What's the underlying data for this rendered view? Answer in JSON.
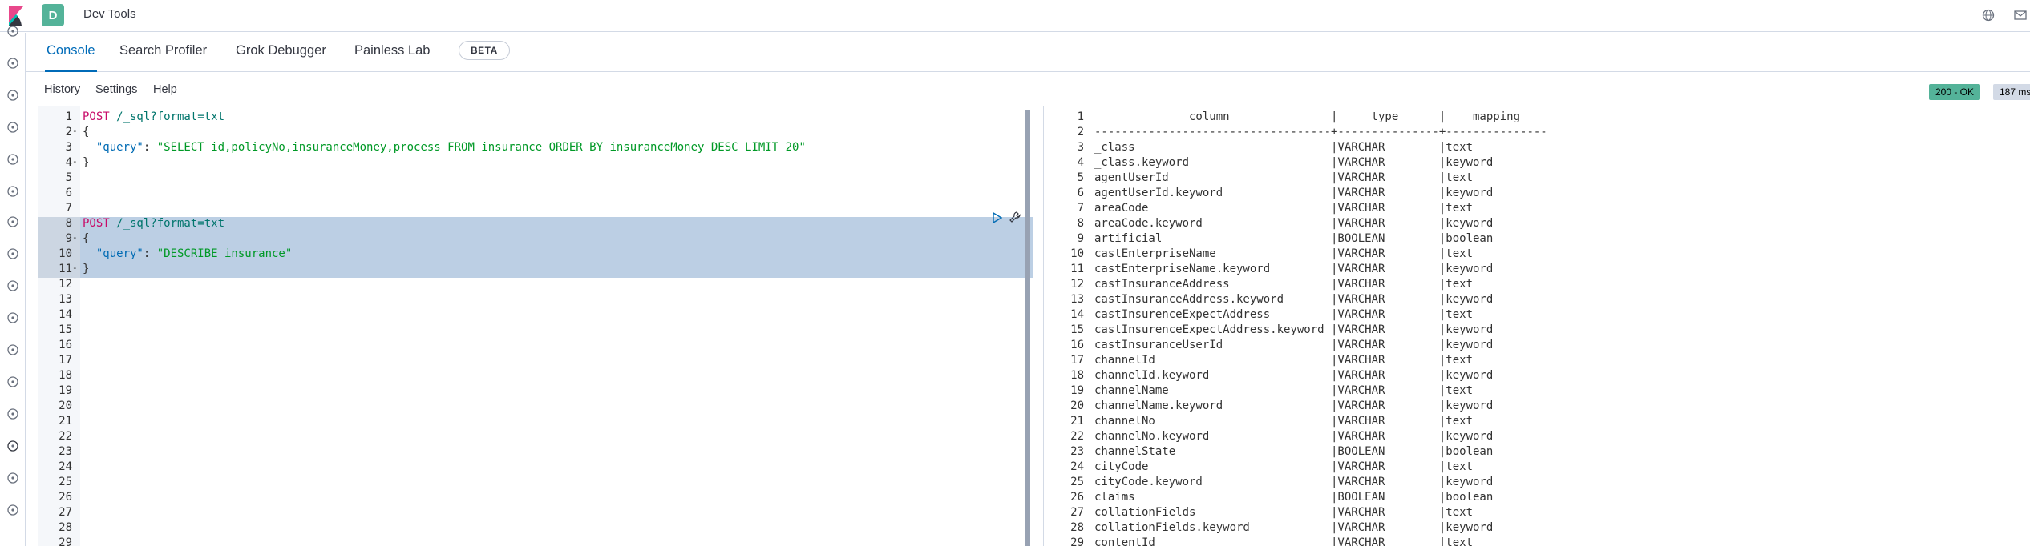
{
  "app": {
    "space_initial": "D",
    "title": "Dev Tools"
  },
  "tabs": [
    {
      "label": "Console",
      "active": true
    },
    {
      "label": "Search Profiler",
      "active": false
    },
    {
      "label": "Grok Debugger",
      "active": false
    },
    {
      "label": "Painless Lab",
      "active": false
    }
  ],
  "beta_badge": "BETA",
  "subnav": {
    "history": "History",
    "settings": "Settings",
    "help": "Help"
  },
  "status": {
    "code": "200 - OK",
    "time": "187 ms"
  },
  "editor": {
    "lines": [
      {
        "n": "1",
        "fold": "",
        "method": "POST",
        "path": " /_sql?format=txt",
        "code": ""
      },
      {
        "n": "2",
        "fold": "-",
        "code": "{"
      },
      {
        "n": "3",
        "fold": "",
        "key": "  \"query\"",
        "str": "\"SELECT id,policyNo,insuranceMoney,process FROM insurance ORDER BY insuranceMoney DESC LIMIT 20\""
      },
      {
        "n": "4",
        "fold": "-",
        "code": "}"
      },
      {
        "n": "5",
        "fold": "",
        "code": ""
      },
      {
        "n": "6",
        "fold": "",
        "code": ""
      },
      {
        "n": "7",
        "fold": "",
        "code": ""
      },
      {
        "n": "8",
        "fold": "",
        "method": "POST",
        "path": " /_sql?format=txt",
        "code": ""
      },
      {
        "n": "9",
        "fold": "-",
        "code": "{"
      },
      {
        "n": "10",
        "fold": "",
        "key": "  \"query\"",
        "str": "\"DESCRIBE insurance\""
      },
      {
        "n": "11",
        "fold": "-",
        "code": "}"
      },
      {
        "n": "12",
        "fold": "",
        "code": ""
      },
      {
        "n": "13",
        "fold": "",
        "code": ""
      },
      {
        "n": "14",
        "fold": "",
        "code": ""
      },
      {
        "n": "15",
        "fold": "",
        "code": ""
      },
      {
        "n": "16",
        "fold": "",
        "code": ""
      },
      {
        "n": "17",
        "fold": "",
        "code": ""
      },
      {
        "n": "18",
        "fold": "",
        "code": ""
      },
      {
        "n": "19",
        "fold": "",
        "code": ""
      },
      {
        "n": "20",
        "fold": "",
        "code": ""
      },
      {
        "n": "21",
        "fold": "",
        "code": ""
      },
      {
        "n": "22",
        "fold": "",
        "code": ""
      },
      {
        "n": "23",
        "fold": "",
        "code": ""
      },
      {
        "n": "24",
        "fold": "",
        "code": ""
      },
      {
        "n": "25",
        "fold": "",
        "code": ""
      },
      {
        "n": "26",
        "fold": "",
        "code": ""
      },
      {
        "n": "27",
        "fold": "",
        "code": ""
      },
      {
        "n": "28",
        "fold": "",
        "code": ""
      },
      {
        "n": "29",
        "fold": "",
        "code": ""
      }
    ]
  },
  "output": {
    "lines": [
      {
        "n": "1",
        "text": "              column               |     type      |    mapping"
      },
      {
        "n": "2",
        "text": "-----------------------------------+---------------+---------------"
      },
      {
        "n": "3",
        "text": "_class                             |VARCHAR        |text"
      },
      {
        "n": "4",
        "text": "_class.keyword                     |VARCHAR        |keyword"
      },
      {
        "n": "5",
        "text": "agentUserId                        |VARCHAR        |text"
      },
      {
        "n": "6",
        "text": "agentUserId.keyword                |VARCHAR        |keyword"
      },
      {
        "n": "7",
        "text": "areaCode                           |VARCHAR        |text"
      },
      {
        "n": "8",
        "text": "areaCode.keyword                   |VARCHAR        |keyword"
      },
      {
        "n": "9",
        "text": "artificial                         |BOOLEAN        |boolean"
      },
      {
        "n": "10",
        "text": "castEnterpriseName                 |VARCHAR        |text"
      },
      {
        "n": "11",
        "text": "castEnterpriseName.keyword         |VARCHAR        |keyword"
      },
      {
        "n": "12",
        "text": "castInsuranceAddress               |VARCHAR        |text"
      },
      {
        "n": "13",
        "text": "castInsuranceAddress.keyword       |VARCHAR        |keyword"
      },
      {
        "n": "14",
        "text": "castInsurenceExpectAddress         |VARCHAR        |text"
      },
      {
        "n": "15",
        "text": "castInsurenceExpectAddress.keyword |VARCHAR        |keyword"
      },
      {
        "n": "16",
        "text": "castInsuranceUserId                |VARCHAR        |keyword"
      },
      {
        "n": "17",
        "text": "channelId                          |VARCHAR        |text"
      },
      {
        "n": "18",
        "text": "channelId.keyword                  |VARCHAR        |keyword"
      },
      {
        "n": "19",
        "text": "channelName                        |VARCHAR        |text"
      },
      {
        "n": "20",
        "text": "channelName.keyword                |VARCHAR        |keyword"
      },
      {
        "n": "21",
        "text": "channelNo                          |VARCHAR        |text"
      },
      {
        "n": "22",
        "text": "channelNo.keyword                  |VARCHAR        |keyword"
      },
      {
        "n": "23",
        "text": "channelState                       |BOOLEAN        |boolean"
      },
      {
        "n": "24",
        "text": "cityCode                           |VARCHAR        |text"
      },
      {
        "n": "25",
        "text": "cityCode.keyword                   |VARCHAR        |keyword"
      },
      {
        "n": "26",
        "text": "claims                             |BOOLEAN        |boolean"
      },
      {
        "n": "27",
        "text": "collationFields                    |VARCHAR        |text"
      },
      {
        "n": "28",
        "text": "collationFields.keyword            |VARCHAR        |keyword"
      },
      {
        "n": "29",
        "text": "contentId                          |VARCHAR        |text"
      }
    ]
  },
  "sidenav_icons": [
    "clock-icon",
    "compass-icon",
    "visualize-icon",
    "dashboard-icon",
    "canvas-icon",
    "maps-icon",
    "ml-icon",
    "graph-icon",
    "observability-icon",
    "logs-icon",
    "metrics-icon",
    "apm-icon",
    "uptime-icon",
    "devtools-icon",
    "monitoring-icon",
    "settings-icon"
  ]
}
